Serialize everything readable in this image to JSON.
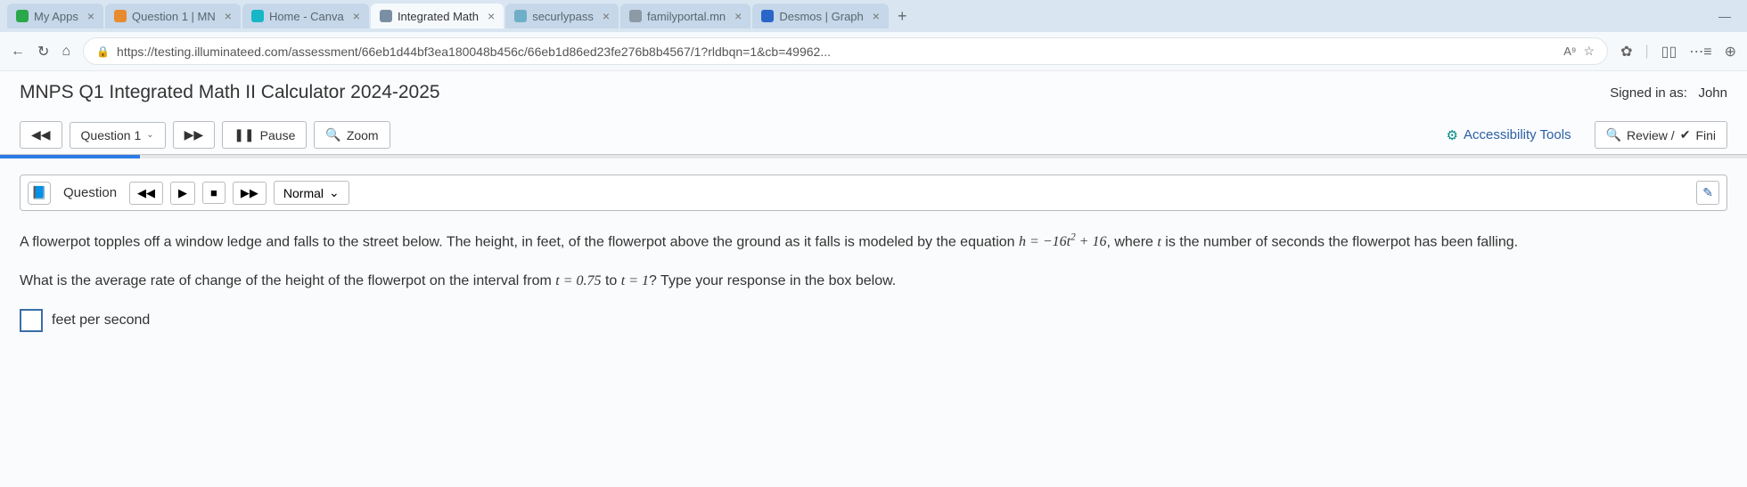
{
  "tabs": [
    {
      "label": "My Apps",
      "favColor": "#2aa84a"
    },
    {
      "label": "Question 1 | MN",
      "favColor": "#e88b2e"
    },
    {
      "label": "Home - Canva",
      "favColor": "#17b6c6"
    },
    {
      "label": "Integrated Math",
      "favColor": "#7a8fa3",
      "active": true
    },
    {
      "label": "securlypass",
      "favColor": "#6faec8"
    },
    {
      "label": "familyportal.mn",
      "favColor": "#8c9aa6"
    },
    {
      "label": "Desmos | Graph",
      "favColor": "#2a66c8"
    }
  ],
  "url": "https://testing.illuminateed.com/assessment/66eb1d44bf3ea180048b456c/66eb1d86ed23fe276b8b4567/1?rldbqn=1&cb=49962...",
  "assess": {
    "title": "MNPS Q1 Integrated Math II Calculator 2024-2025",
    "signedLabel": "Signed in as:",
    "user": "John"
  },
  "nav": {
    "questionSel": "Question 1",
    "pause": "Pause",
    "zoom": "Zoom",
    "accessibility": "Accessibility Tools",
    "review": "Review /",
    "finish": "Fini"
  },
  "qbar": {
    "title": "Question",
    "mode": "Normal"
  },
  "question": {
    "p1a": "A flowerpot topples off a window ledge and falls to the street below. The height, in feet, of the flowerpot above the ground as it falls is modeled by the equation ",
    "eq1": "h = −16t² + 16",
    "p1b": ", where ",
    "tvar": "t",
    "p1c": " is the number of seconds the flowerpot has been falling.",
    "p2a": "What is the average rate of change of the height of the flowerpot on the interval from ",
    "eq2": "t = 0.75",
    "p2b": " to ",
    "eq3": "t = 1",
    "p2c": "? Type your response in the box below.",
    "unit": "feet per second"
  }
}
